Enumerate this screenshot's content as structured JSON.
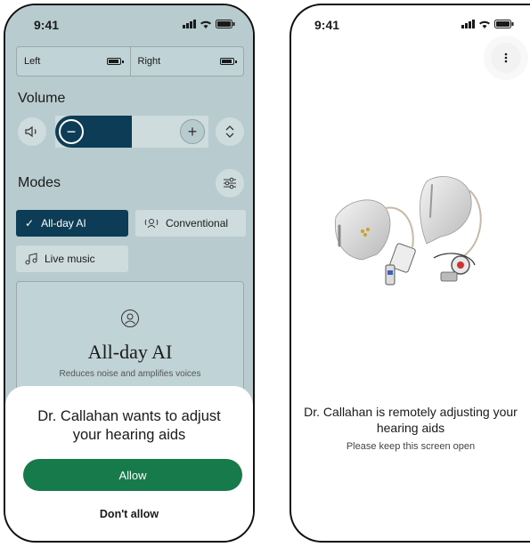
{
  "left_screen": {
    "status": {
      "time": "9:41"
    },
    "devices": {
      "left_label": "Left",
      "right_label": "Right"
    },
    "volume": {
      "title": "Volume",
      "minus": "−",
      "plus": "+",
      "level": 0.5
    },
    "modes": {
      "title": "Modes",
      "items": [
        {
          "label": "All-day AI",
          "active": true
        },
        {
          "label": "Conventional",
          "active": false
        },
        {
          "label": "Live music",
          "active": false
        }
      ]
    },
    "mode_card": {
      "title": "All-day AI",
      "description": "Reduces noise and amplifies voices"
    },
    "sheet": {
      "title": "Dr. Callahan wants to adjust your hearing aids",
      "allow_label": "Allow",
      "deny_label": "Don't allow"
    }
  },
  "right_screen": {
    "status": {
      "time": "9:41"
    },
    "remote_title": "Dr. Callahan is remotely adjusting your hearing aids",
    "remote_subtitle": "Please keep this screen open"
  },
  "colors": {
    "accent_green": "#177a4b",
    "accent_navy": "#0d3d56",
    "overlay_teal": "#b8cccf"
  }
}
